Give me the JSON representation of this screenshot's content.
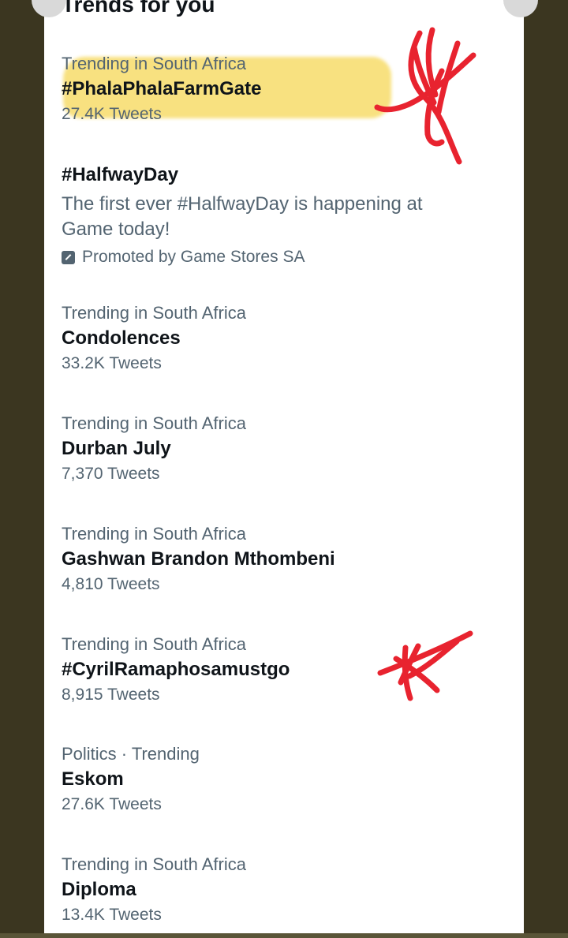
{
  "header": {
    "title": "Trends for you"
  },
  "trends": [
    {
      "context": "Trending in South Africa",
      "name": "#PhalaPhalaFarmGate",
      "count": "27.4K Tweets"
    },
    {
      "context": "Trending in South Africa",
      "name": "Condolences",
      "count": "33.2K Tweets"
    },
    {
      "context": "Trending in South Africa",
      "name": "Durban July",
      "count": "7,370 Tweets"
    },
    {
      "context": "Trending in South Africa",
      "name": "Gashwan Brandon Mthombeni",
      "count": "4,810 Tweets"
    },
    {
      "context": "Trending in South Africa",
      "name": "#CyrilRamaphosamustgo",
      "count": "8,915 Tweets"
    },
    {
      "context": "Politics · Trending",
      "name": "Eskom",
      "count": "27.6K Tweets"
    },
    {
      "context": "Trending in South Africa",
      "name": "Diploma",
      "count": "13.4K Tweets"
    }
  ],
  "promoted": {
    "name": "#HalfwayDay",
    "description": "The first ever #HalfwayDay is happening at Game today!",
    "promoted_by": "Promoted by Game Stores SA",
    "icon": "promoted-icon"
  },
  "annotations": {
    "highlight_color": "#f7dc6a",
    "mark_color": "#e8232f"
  }
}
